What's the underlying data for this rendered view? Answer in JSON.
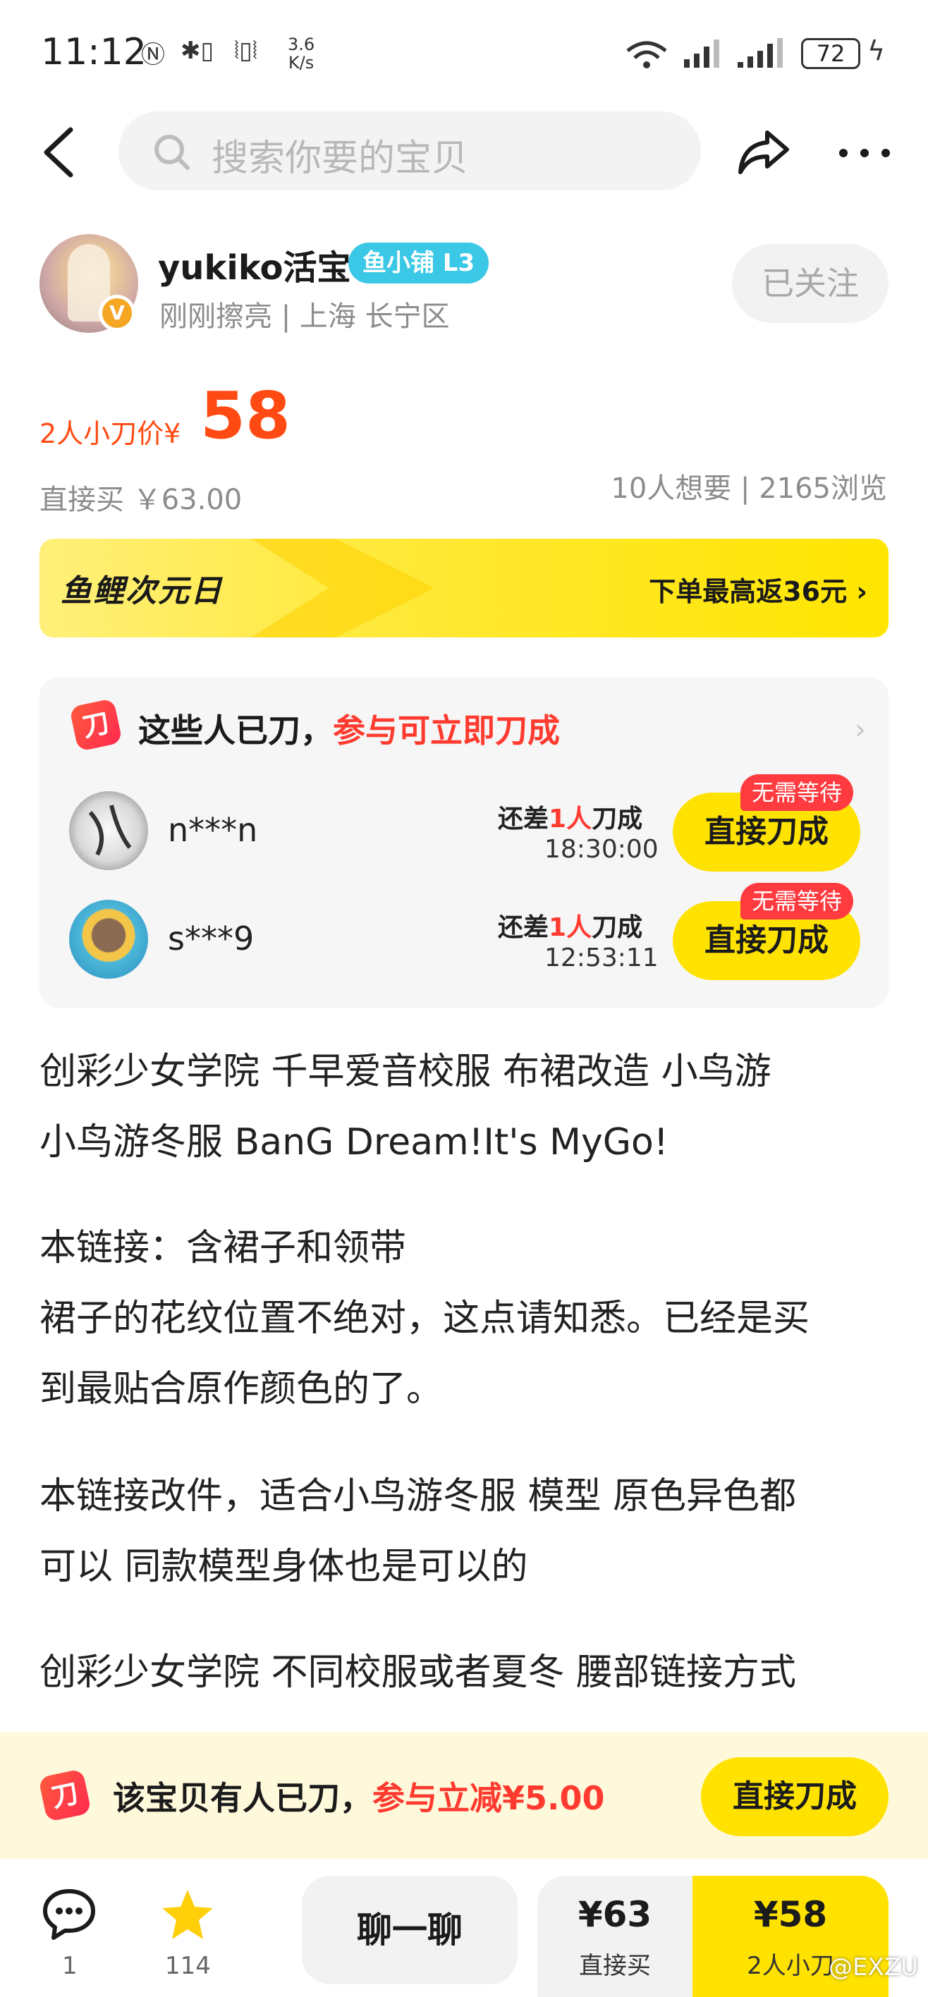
{
  "status_bar": {
    "time": "11:12",
    "net_speed_value": "3.6",
    "net_speed_unit": "K/s",
    "battery": "72"
  },
  "header": {
    "search_placeholder": "搜索你要的宝贝"
  },
  "seller": {
    "name": "yukiko活宝",
    "shop_badge": "鱼小铺 L3",
    "meta": "刚刚擦亮 | 上海 长宁区",
    "verified": "V",
    "follow_label": "已关注"
  },
  "price": {
    "label": "2人小刀价¥",
    "value": "58",
    "direct_buy": "直接买  ￥63.00",
    "stats": "10人想要 | 2165浏览"
  },
  "banner": {
    "logo": "鱼鲤次元日",
    "rebate": "下单最高返36元 ›"
  },
  "cut_card": {
    "icon_text": "刀",
    "title_black": "这些人已刀，",
    "title_red": "参与可立即刀成",
    "rows": [
      {
        "name": "n***n",
        "need_prefix": "还差",
        "need_num": "1人",
        "need_suffix": "刀成",
        "countdown": "18:30:00",
        "button": "直接刀成",
        "tag": "无需等待"
      },
      {
        "name": "s***9",
        "need_prefix": "还差",
        "need_num": "1人",
        "need_suffix": "刀成",
        "countdown": "12:53:11",
        "button": "直接刀成",
        "tag": "无需等待"
      }
    ]
  },
  "description": [
    "创彩少女学院 千早爱音校服  布裙改造 小鸟游",
    "小鸟游冬服 BanG Dream!It's MyGo!",
    "本链接：含裙子和领带",
    "裙子的花纹位置不绝对，这点请知悉。已经是买",
    "到最贴合原作颜色的了。",
    "本链接改件，适合小鸟游冬服 模型  原色异色都",
    "可以 同款模型身体也是可以的",
    "创彩少女学院 不同校服或者夏冬 腰部链接方式"
  ],
  "cut_bar": {
    "icon_text": "刀",
    "text_black": "该宝贝有人已刀，",
    "text_red": "参与立减¥5.00",
    "button": "直接刀成"
  },
  "bottom_bar": {
    "chat_count": "1",
    "fav_count": "114",
    "talk_label": "聊一聊",
    "direct_price": "¥63",
    "direct_label": "直接买",
    "cut_price": "¥58",
    "cut_label": "2人小刀"
  },
  "watermark": "@EXZU",
  "colors": {
    "accent_yellow": "#ffe200",
    "price_orange": "#ff4b13",
    "red": "#ff3b30",
    "badge_blue": "#3ac8e6"
  }
}
